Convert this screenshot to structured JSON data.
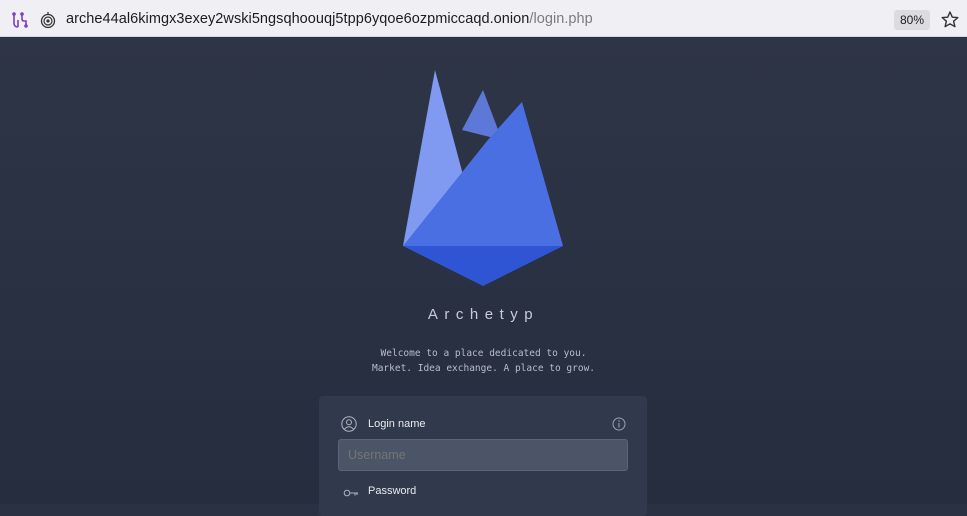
{
  "browser": {
    "url_domain": "arche44al6kimgx3exey2wski5ngsqhoouqj5tpp6yqoe6ozpmiccaqd.onion",
    "url_path": "/login.php",
    "zoom": "80%",
    "icons": [
      "tor-circuit-icon",
      "onion-icon",
      "bookmark-star-icon"
    ]
  },
  "page": {
    "brand": "Archetyp",
    "tagline_line1": "Welcome to a place dedicated to you.",
    "tagline_line2": "Market. Idea exchange. A place to grow."
  },
  "login_form": {
    "login_label": "Login name",
    "username_placeholder": "Username",
    "password_label": "Password",
    "icons": [
      "user-icon",
      "info-icon",
      "key-icon"
    ]
  },
  "colors": {
    "page_background": "#2a3142",
    "card_background": "#313a4c",
    "logo_blue": "#4a6fe3"
  }
}
